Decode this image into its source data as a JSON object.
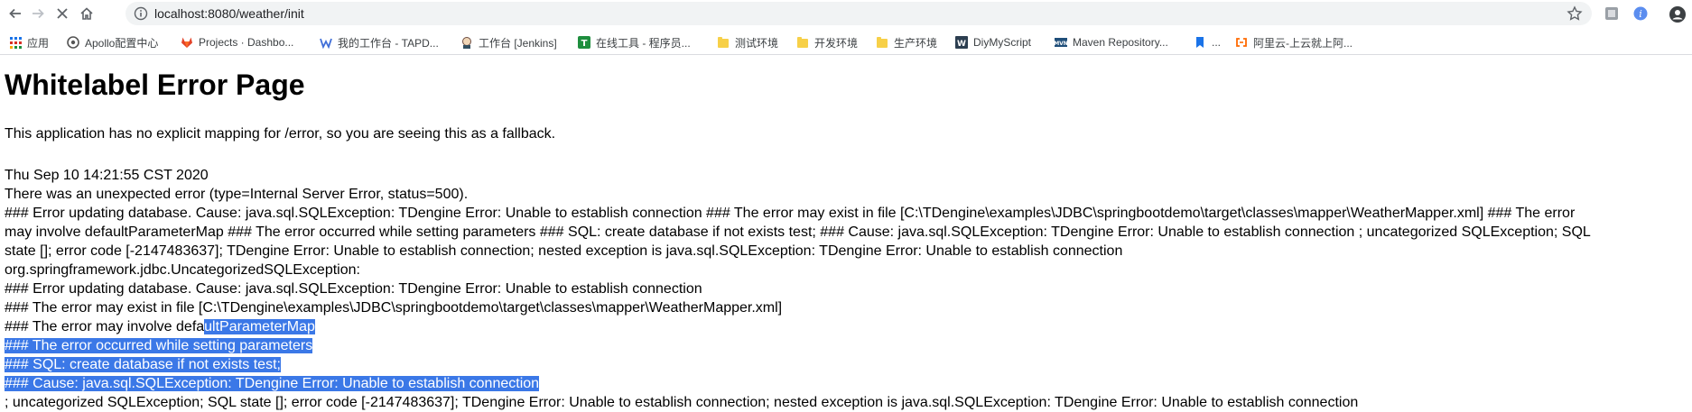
{
  "browser": {
    "url": "localhost:8080/weather/init",
    "bookmarks": [
      {
        "label": "应用",
        "icon": "apps-grid-icon"
      },
      {
        "label": "Apollo配置中心",
        "icon": "apollo-icon"
      },
      {
        "label": "Projects · Dashbo...",
        "icon": "gitlab-icon"
      },
      {
        "label": "我的工作台 - TAPD...",
        "icon": "tapd-icon"
      },
      {
        "label": "工作台 [Jenkins]",
        "icon": "jenkins-icon"
      },
      {
        "label": "在线工具 - 程序员...",
        "icon": "tool-icon"
      },
      {
        "label": "测试环境",
        "icon": "folder-icon"
      },
      {
        "label": "开发环境",
        "icon": "folder-icon"
      },
      {
        "label": "生产环境",
        "icon": "folder-icon"
      },
      {
        "label": "DiyMyScript",
        "icon": "script-icon"
      },
      {
        "label": "Maven Repository...",
        "icon": "maven-icon"
      },
      {
        "label": "...",
        "icon": "bookmark-icon"
      },
      {
        "label": "阿里云-上云就上阿...",
        "icon": "aliyun-icon"
      }
    ]
  },
  "page": {
    "title": "Whitelabel Error Page",
    "intro": "This application has no explicit mapping for /error, so you are seeing this as a fallback.",
    "timestamp": "Thu Sep 10 14:21:55 CST 2020",
    "error_summary": "There was an unexpected error (type=Internal Server Error, status=500).",
    "wrapped_lines": [
      "### Error updating database. Cause: java.sql.SQLException: TDengine Error: Unable to establish connection ### The error may exist in file [C:\\TDengine\\examples\\JDBC\\springbootdemo\\target\\classes\\mapper\\WeatherMapper.xml] ### The error",
      "may involve defaultParameterMap ### The error occurred while setting parameters ### SQL: create database if not exists test; ### Cause: java.sql.SQLException: TDengine Error: Unable to establish connection ; uncategorized SQLException; SQL",
      "state []; error code [-2147483637]; TDengine Error: Unable to establish connection; nested exception is java.sql.SQLException: TDengine Error: Unable to establish connection",
      "org.springframework.jdbc.UncategorizedSQLException:",
      "### Error updating database.  Cause: java.sql.SQLException: TDengine Error: Unable to establish connection",
      "### The error may exist in file [C:\\TDengine\\examples\\JDBC\\springbootdemo\\target\\classes\\mapper\\WeatherMapper.xml]"
    ],
    "involve_prefix": "### The error may involve defa",
    "involve_selected": "ultParameterMap",
    "selected_lines": [
      "### The error occurred while setting parameters",
      "### SQL: create database if not exists test;",
      "### Cause: java.sql.SQLException: TDengine Error: Unable to establish connection"
    ],
    "last_line": "; uncategorized SQLException; SQL state []; error code [-2147483637]; TDengine Error: Unable to establish connection; nested exception is java.sql.SQLException: TDengine Error: Unable to establish connection"
  },
  "colors": {
    "selection": "#3b78e7",
    "omnibox": "#f1f3f4"
  }
}
